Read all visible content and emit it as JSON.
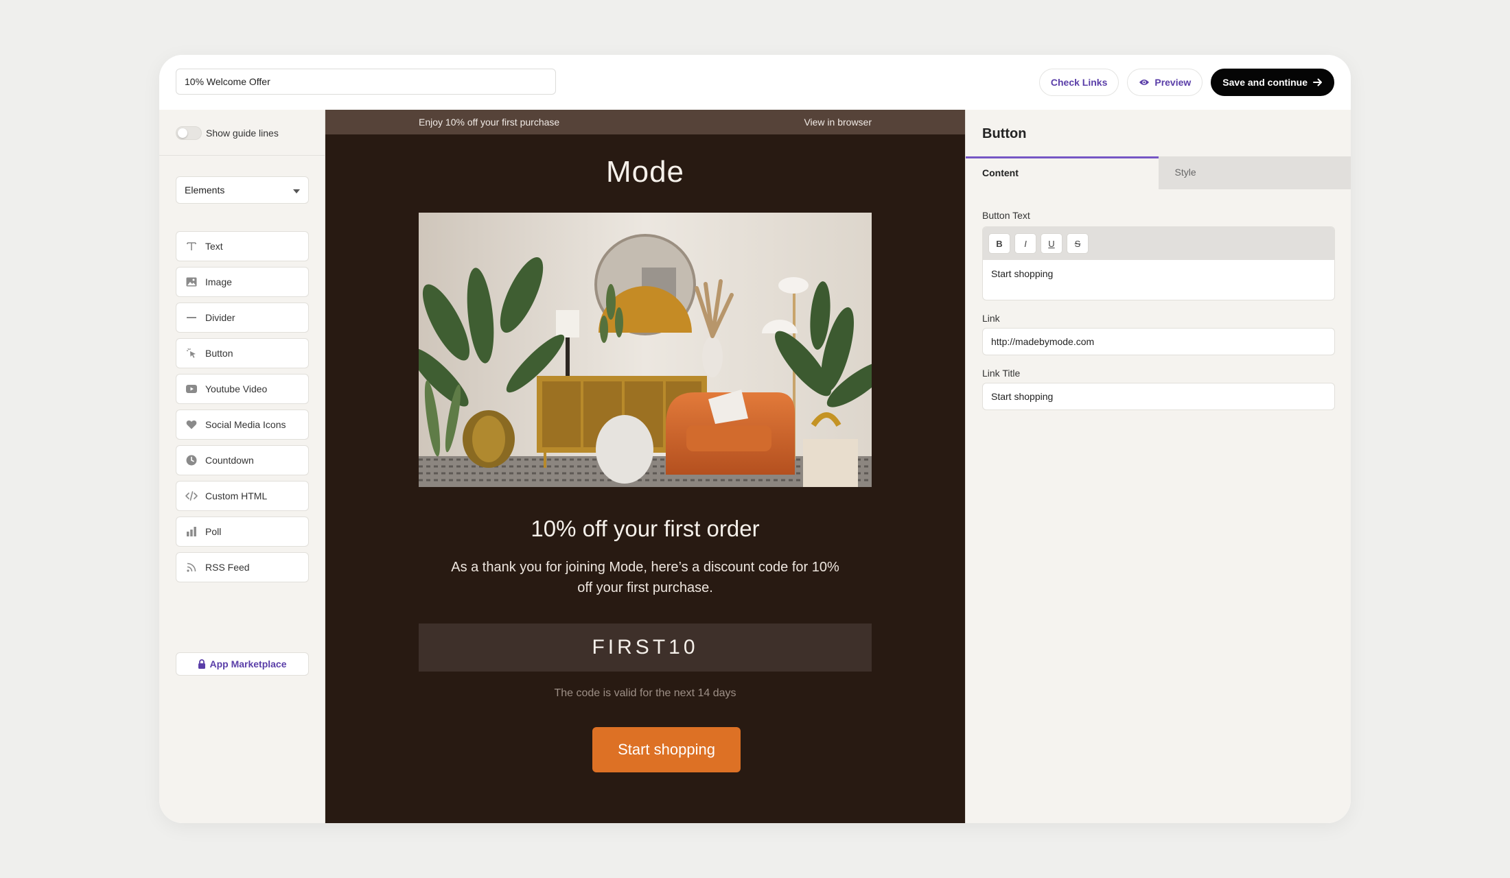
{
  "topbar": {
    "campaign_name": "10% Welcome Offer",
    "check_links": "Check Links",
    "preview": "Preview",
    "save": "Save and continue"
  },
  "sidebar": {
    "guide_lines": "Show guide lines",
    "dropdown": "Elements",
    "items": [
      {
        "label": "Text",
        "icon": "text-icon"
      },
      {
        "label": "Image",
        "icon": "image-icon"
      },
      {
        "label": "Divider",
        "icon": "divider-icon"
      },
      {
        "label": "Button",
        "icon": "cursor-click-icon"
      },
      {
        "label": "Youtube Video",
        "icon": "youtube-icon"
      },
      {
        "label": "Social Media Icons",
        "icon": "heart-icon"
      },
      {
        "label": "Countdown",
        "icon": "clock-icon"
      },
      {
        "label": "Custom HTML",
        "icon": "code-icon"
      },
      {
        "label": "Poll",
        "icon": "bar-chart-icon"
      },
      {
        "label": "RSS Feed",
        "icon": "rss-icon"
      }
    ],
    "marketplace": "App Marketplace"
  },
  "email": {
    "preheader": "Enjoy 10% off your first purchase",
    "view_in_browser": "View in browser",
    "brand": "Mode",
    "headline": "10% off your first order",
    "body": "As a thank you for joining Mode, here’s a discount code for 10% off your first purchase.",
    "code": "FIRST10",
    "validity": "The code is valid for the next 14 days",
    "cta": "Start shopping"
  },
  "panel": {
    "title": "Button",
    "tabs": [
      "Content",
      "Style"
    ],
    "button_text_label": "Button Text",
    "format_buttons": [
      "B",
      "I",
      "U",
      "S"
    ],
    "button_text": "Start shopping",
    "link_label": "Link",
    "link": "http://madebymode.com",
    "link_title_label": "Link Title",
    "link_title": "Start shopping"
  },
  "colors": {
    "accent": "#5a3ea8",
    "canvas_bg": "#281a12",
    "cta": "#dd7125",
    "code_box": "#3e302a"
  }
}
